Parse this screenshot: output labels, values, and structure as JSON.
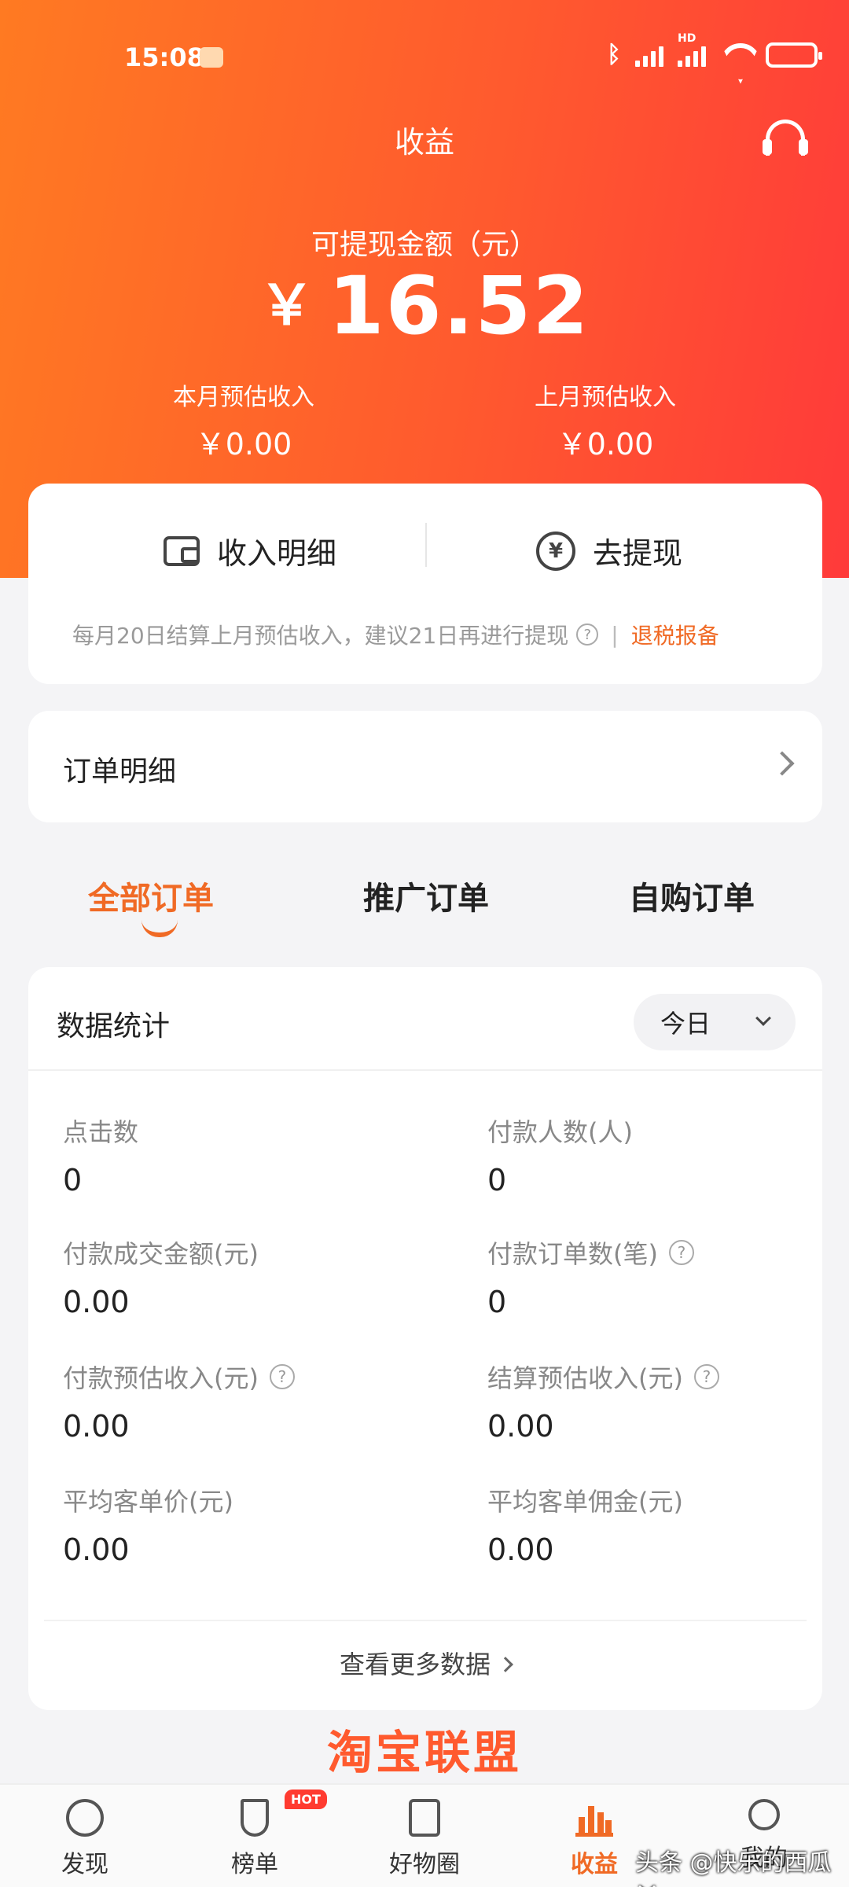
{
  "status_bar": {
    "time": "15:08",
    "hd_tag": "HD"
  },
  "header": {
    "title": "收益"
  },
  "balance": {
    "label": "可提现金额（元）",
    "currency": "￥",
    "amount": "16.52",
    "this_month_label": "本月预估收入",
    "this_month_value": "￥0.00",
    "last_month_label": "上月预估收入",
    "last_month_value": "￥0.00"
  },
  "actions": {
    "income_detail": "收入明细",
    "withdraw": "去提现",
    "notice": "每月20日结算上月预估收入，建议21日再进行提现",
    "notice_sep": "|",
    "tax_link": "退税报备"
  },
  "orders": {
    "title": "订单明细"
  },
  "tabs": [
    "全部订单",
    "推广订单",
    "自购订单"
  ],
  "stats": {
    "title": "数据统计",
    "period": "今日",
    "items": [
      {
        "label": "点击数",
        "value": "0"
      },
      {
        "label": "付款人数(人)",
        "value": "0"
      },
      {
        "label": "付款成交金额(元)",
        "value": "0.00"
      },
      {
        "label": "付款订单数(笔)",
        "value": "0"
      },
      {
        "label": "付款预估收入(元)",
        "value": "0.00"
      },
      {
        "label": "结算预估收入(元)",
        "value": "0.00"
      },
      {
        "label": "平均客单价(元)",
        "value": "0.00"
      },
      {
        "label": "平均客单佣金(元)",
        "value": "0.00"
      }
    ],
    "more": "查看更多数据"
  },
  "brand_caption": "淘宝联盟",
  "tabbar": {
    "items": [
      "发现",
      "榜单",
      "好物圈",
      "收益",
      "我的"
    ],
    "hot_badge": "HOT",
    "active": "收益"
  },
  "watermark": "头条 @快乐的西瓜丫",
  "colors": {
    "accent": "#f06a25",
    "hero_start": "#ff7a22",
    "hero_end": "#ff3a3a"
  }
}
